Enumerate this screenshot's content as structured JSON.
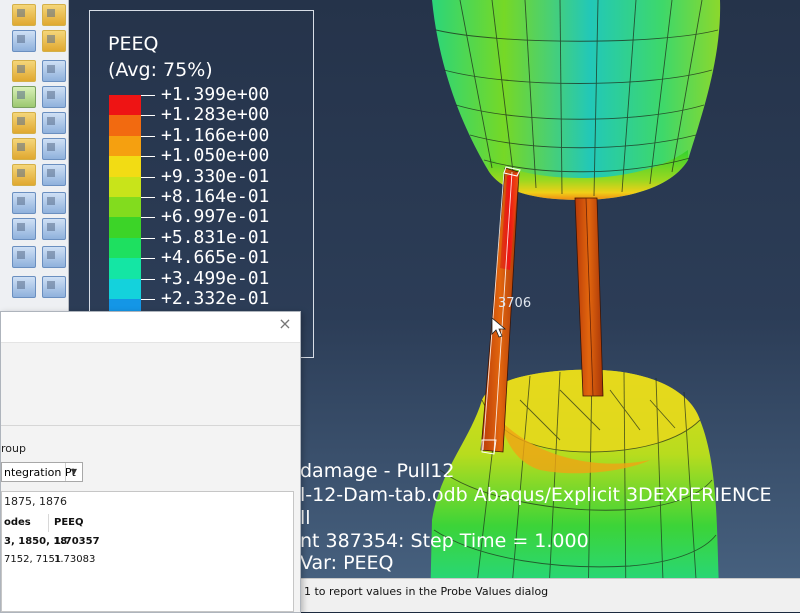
{
  "legend": {
    "title": "PEEQ",
    "averaging": "(Avg: 75%)",
    "entries": [
      {
        "value": "+1.399e+00",
        "color": "#ee1414"
      },
      {
        "value": "+1.283e+00",
        "color": "#f26a10"
      },
      {
        "value": "+1.166e+00",
        "color": "#f5a010"
      },
      {
        "value": "+1.050e+00",
        "color": "#f2dc14"
      },
      {
        "value": "+9.330e-01",
        "color": "#c8e41a"
      },
      {
        "value": "+8.164e-01",
        "color": "#82dc1e"
      },
      {
        "value": "+6.997e-01",
        "color": "#3cd428"
      },
      {
        "value": "+5.831e-01",
        "color": "#1ee060"
      },
      {
        "value": "+4.665e-01",
        "color": "#14e6a4"
      },
      {
        "value": "+3.499e-01",
        "color": "#14d2dc"
      },
      {
        "value": "+2.332e-01",
        "color": "#1496e6"
      }
    ]
  },
  "viewport": {
    "node_label": "3706",
    "info_lines": [
      "damage - Pull12",
      "l-12-Dam-tab.odb    Abaqus/Explicit 3DEXPERIENCE",
      "ll",
      "nt    387354: Step Time =     1.000",
      "Var: PEEQ"
    ]
  },
  "status_bar": {
    "text": "1 to report values in the Probe Values dialog"
  },
  "probe_dialog": {
    "close_glyph": "×",
    "group_label": "roup",
    "position_value": "ntegration Pt",
    "element_nodes": "1875, 1876",
    "columns": [
      "odes",
      "PEEQ"
    ],
    "rows": [
      {
        "nodes": "3, 1850, 18",
        "peeq": "1.70357",
        "bold": true
      },
      {
        "nodes": "7152, 7151",
        "peeq": "1.73083",
        "bold": false
      }
    ]
  },
  "toolbox": {
    "icons": [
      "field-output-icon",
      "contour-plot-icon",
      "symbol-plot-icon",
      "material-orientation-icon",
      "animate-icon",
      "probe-icon",
      "report-icon",
      "xy-data-icon",
      "query-icon",
      "table-icon"
    ]
  }
}
